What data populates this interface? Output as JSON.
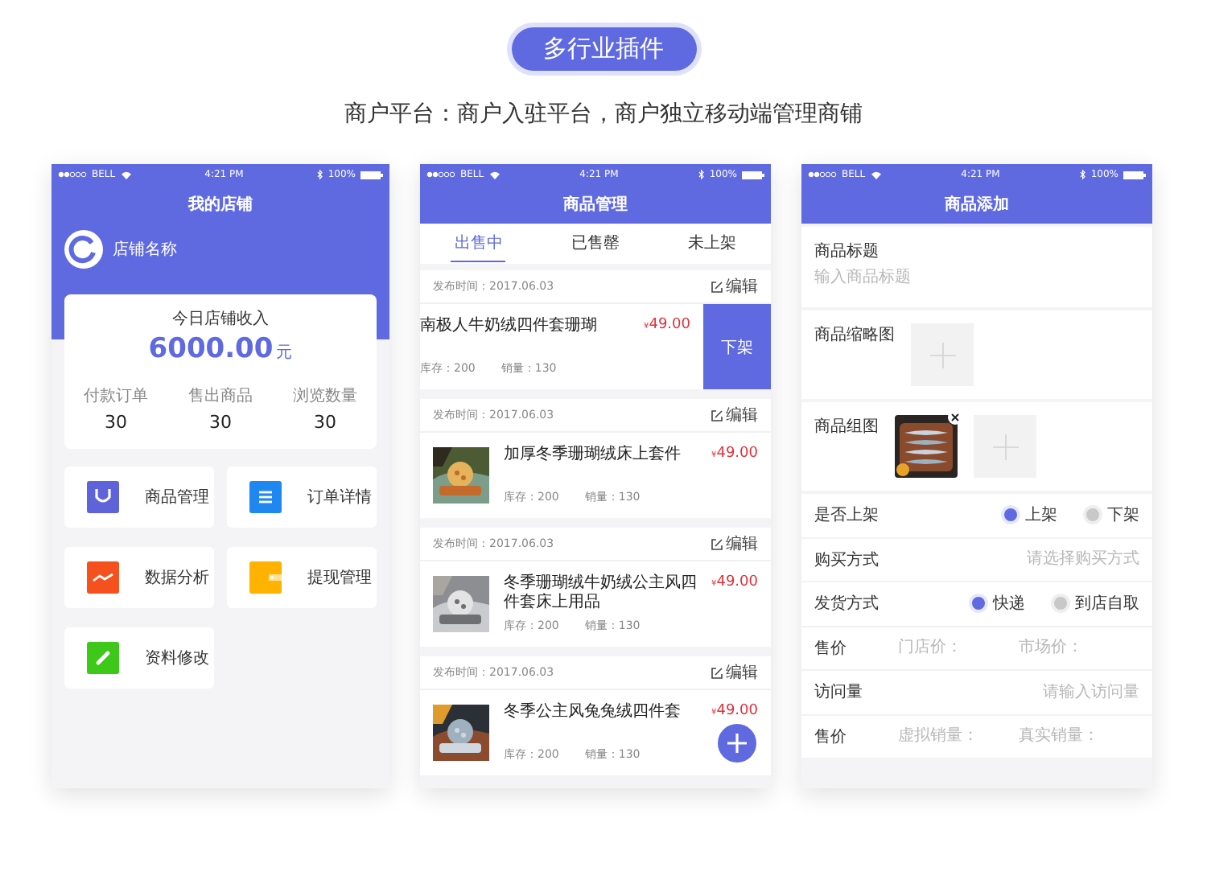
{
  "badge": "多行业插件",
  "subtitle": "商户平台：商户入驻平台，商户独立移动端管理商铺",
  "shop_screen": {
    "status_bar": {
      "carrier": "BELL",
      "time": "4:21 PM",
      "battery": "100%"
    },
    "title": "我的店铺",
    "shop_name": "店铺名称",
    "income_label": "今日店铺收入",
    "income": "6000.00",
    "unit": "元",
    "stats": [
      {
        "label": "付款订单",
        "value": "30"
      },
      {
        "label": "售出商品",
        "value": "30"
      },
      {
        "label": "浏览数量",
        "value": "30"
      }
    ],
    "menu": [
      {
        "label": "商品管理",
        "kind": "bag",
        "color": "#5f63d9"
      },
      {
        "label": "订单详情",
        "kind": "list",
        "color": "#1e88f0"
      },
      {
        "label": "数据分析",
        "kind": "chart",
        "color": "#f4511e"
      },
      {
        "label": "提现管理",
        "kind": "wallet",
        "color": "#ffb300"
      },
      {
        "label": "资料修改",
        "kind": "edit",
        "color": "#3ec81a"
      }
    ]
  },
  "goods_screen": {
    "status_bar": {
      "carrier": "BELL",
      "time": "4:21 PM",
      "battery": "100%"
    },
    "title": "商品管理",
    "tabs": [
      {
        "label": "出售中",
        "selected": true
      },
      {
        "label": "已售罄",
        "selected": false
      },
      {
        "label": "未上架",
        "selected": false
      }
    ],
    "items": [
      {
        "date": "发布时间：2017.06.03",
        "edit": "编辑",
        "name": "南极人牛奶绒四件套珊瑚",
        "price": "49.00",
        "currency": "¥",
        "stock": "库存：200",
        "sales": "销量：130",
        "swiped": true,
        "action": "下架"
      },
      {
        "date": "发布时间：2017.06.03",
        "edit": "编辑",
        "name": "加厚冬季珊瑚绒床上套件",
        "price": "49.00",
        "currency": "¥",
        "stock": "库存：200",
        "sales": "销量：130",
        "swiped": false
      },
      {
        "date": "发布时间：2017.06.03",
        "edit": "编辑",
        "name": "冬季珊瑚绒牛奶绒公主风四件套床上用品",
        "price": "49.00",
        "currency": "¥",
        "stock": "库存：200",
        "sales": "销量：130",
        "swiped": false
      },
      {
        "date": "发布时间：2017.06.03",
        "edit": "编辑",
        "name": "冬季公主风兔兔绒四件套",
        "price": "49.00",
        "currency": "¥",
        "stock": "库存：200",
        "sales": "销量：130",
        "swiped": false
      }
    ]
  },
  "add_screen": {
    "status_bar": {
      "carrier": "BELL",
      "time": "4:21 PM",
      "battery": "100%"
    },
    "title": "商品添加",
    "title_field": {
      "label": "商品标题",
      "placeholder": "输入商品标题"
    },
    "thumbnail": {
      "label": "商品缩略图"
    },
    "gallery": {
      "label": "商品组图"
    },
    "rows": [
      {
        "kind": "radio",
        "label": "是否上架",
        "options": [
          {
            "label": "上架",
            "selected": true
          },
          {
            "label": "下架",
            "selected": false
          }
        ]
      },
      {
        "kind": "select",
        "label": "购买方式",
        "placeholder": "请选择购买方式"
      },
      {
        "kind": "radio",
        "label": "发货方式",
        "options": [
          {
            "label": "快递",
            "selected": true
          },
          {
            "label": "到店自取",
            "selected": false
          }
        ]
      },
      {
        "kind": "pair",
        "label": "售价",
        "fields": [
          {
            "placeholder": "门店价："
          },
          {
            "placeholder": "市场价："
          }
        ]
      },
      {
        "kind": "input",
        "label": "访问量",
        "placeholder": "请输入访问量"
      },
      {
        "kind": "pair",
        "label": "售价",
        "fields": [
          {
            "placeholder": "虚拟销量："
          },
          {
            "placeholder": "真实销量："
          }
        ]
      }
    ]
  }
}
